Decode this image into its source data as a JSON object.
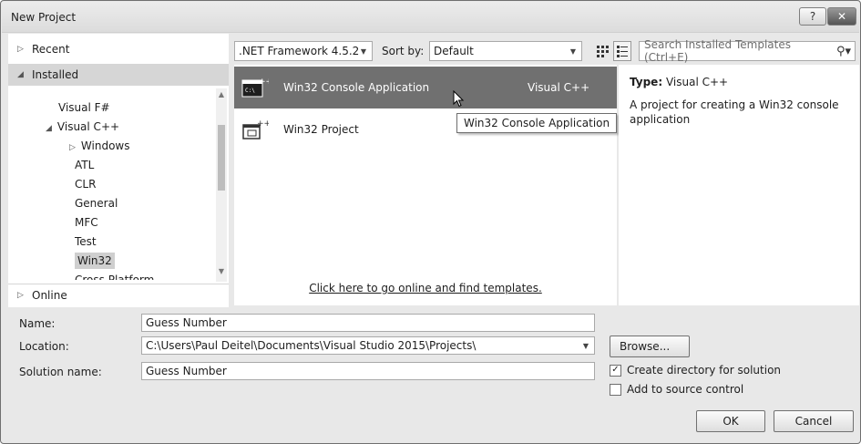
{
  "window": {
    "title": "New Project",
    "help_glyph": "?",
    "close_glyph": "✕"
  },
  "nav": {
    "recent": "Recent",
    "installed": "Installed",
    "online": "Online",
    "tree": [
      {
        "label": "Visual F#",
        "indent": 0
      },
      {
        "label": "Visual C++",
        "indent": 0,
        "expanded": true
      },
      {
        "label": "Windows",
        "indent": 1,
        "collapsed": true
      },
      {
        "label": "ATL",
        "indent": 1
      },
      {
        "label": "CLR",
        "indent": 1
      },
      {
        "label": "General",
        "indent": 1
      },
      {
        "label": "MFC",
        "indent": 1
      },
      {
        "label": "Test",
        "indent": 1
      },
      {
        "label": "Win32",
        "indent": 1,
        "selected": true
      },
      {
        "label": "Cross Platform",
        "indent": 1
      }
    ]
  },
  "toolbar": {
    "framework": ".NET Framework 4.5.2",
    "sort_label": "Sort by:",
    "sort_value": "Default",
    "search_placeholder": "Search Installed Templates (Ctrl+E)"
  },
  "templates": [
    {
      "name": "Win32 Console Application",
      "language": "Visual C++",
      "selected": true,
      "icon": "console-app-icon"
    },
    {
      "name": "Win32 Project",
      "language": "",
      "selected": false,
      "icon": "win32-project-icon"
    }
  ],
  "tooltip": "Win32 Console Application",
  "online_link": "Click here to go online and find templates.",
  "details": {
    "type_label": "Type:",
    "type_value": "Visual C++",
    "description": "A project for creating a Win32 console application"
  },
  "form": {
    "name_label": "Name:",
    "name_value": "Guess Number",
    "location_label": "Location:",
    "location_value": "C:\\Users\\Paul Deitel\\Documents\\Visual Studio 2015\\Projects\\",
    "solution_label": "Solution name:",
    "solution_value": "Guess Number",
    "browse": "Browse...",
    "create_dir": "Create directory for solution",
    "create_dir_checked": true,
    "add_source": "Add to source control",
    "add_source_checked": false,
    "ok": "OK",
    "cancel": "Cancel"
  },
  "colors": {
    "selection": "#707070",
    "panel": "#ffffff",
    "chrome": "#e8e8e8"
  }
}
